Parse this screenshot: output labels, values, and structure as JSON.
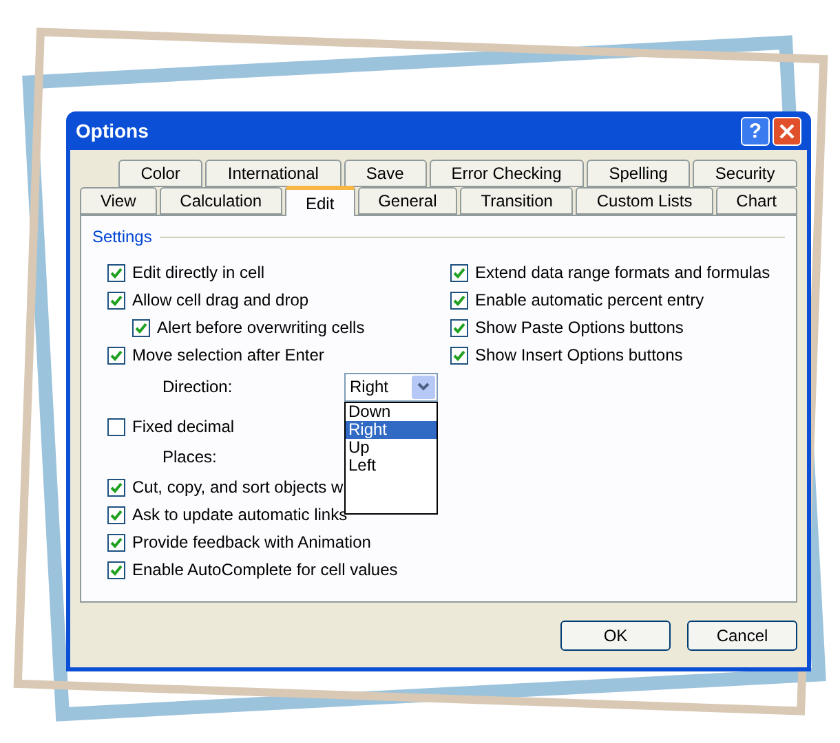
{
  "window": {
    "title": "Options",
    "help_button": "?"
  },
  "tab_rows": [
    [
      {
        "label": "Color",
        "selected": false
      },
      {
        "label": "International",
        "selected": false
      },
      {
        "label": "Save",
        "selected": false
      },
      {
        "label": "Error Checking",
        "selected": false
      },
      {
        "label": "Spelling",
        "selected": false
      },
      {
        "label": "Security",
        "selected": false
      }
    ],
    [
      {
        "label": "View",
        "selected": false
      },
      {
        "label": "Calculation",
        "selected": false
      },
      {
        "label": "Edit",
        "selected": true
      },
      {
        "label": "General",
        "selected": false
      },
      {
        "label": "Transition",
        "selected": false
      },
      {
        "label": "Custom Lists",
        "selected": false
      },
      {
        "label": "Chart",
        "selected": false
      }
    ]
  ],
  "settings": {
    "group_label": "Settings",
    "left": [
      {
        "kind": "checkbox",
        "label": "Edit directly in cell",
        "checked": true
      },
      {
        "kind": "checkbox",
        "label": "Allow cell drag and drop",
        "checked": true,
        "children": [
          {
            "kind": "checkbox",
            "label": "Alert before overwriting cells",
            "checked": true
          }
        ]
      },
      {
        "kind": "checkbox",
        "label": "Move selection after Enter",
        "checked": true,
        "children": [
          {
            "kind": "dropdown",
            "label": "Direction:",
            "value": "Right",
            "expanded": true,
            "options": [
              {
                "label": "Down",
                "selected": false
              },
              {
                "label": "Right",
                "selected": true
              },
              {
                "label": "Up",
                "selected": false
              },
              {
                "label": "Left",
                "selected": false
              }
            ]
          }
        ]
      },
      {
        "kind": "checkbox",
        "label": "Fixed decimal",
        "checked": false,
        "children": [
          {
            "kind": "field",
            "label": "Places:"
          }
        ]
      },
      {
        "kind": "checkbox",
        "label": "Cut, copy, and sort objects w",
        "checked": true
      },
      {
        "kind": "checkbox",
        "label": "Ask to update automatic links",
        "checked": true
      },
      {
        "kind": "checkbox",
        "label": "Provide feedback with Animation",
        "checked": true
      },
      {
        "kind": "checkbox",
        "label": "Enable AutoComplete for cell values",
        "checked": true
      }
    ],
    "right": [
      {
        "kind": "checkbox",
        "label": "Extend data range formats and formulas",
        "checked": true
      },
      {
        "kind": "checkbox",
        "label": "Enable automatic percent entry",
        "checked": true
      },
      {
        "kind": "checkbox",
        "label": "Show Paste Options buttons",
        "checked": true
      },
      {
        "kind": "checkbox",
        "label": "Show Insert Options buttons",
        "checked": true
      }
    ]
  },
  "buttons": [
    "OK",
    "Cancel"
  ]
}
